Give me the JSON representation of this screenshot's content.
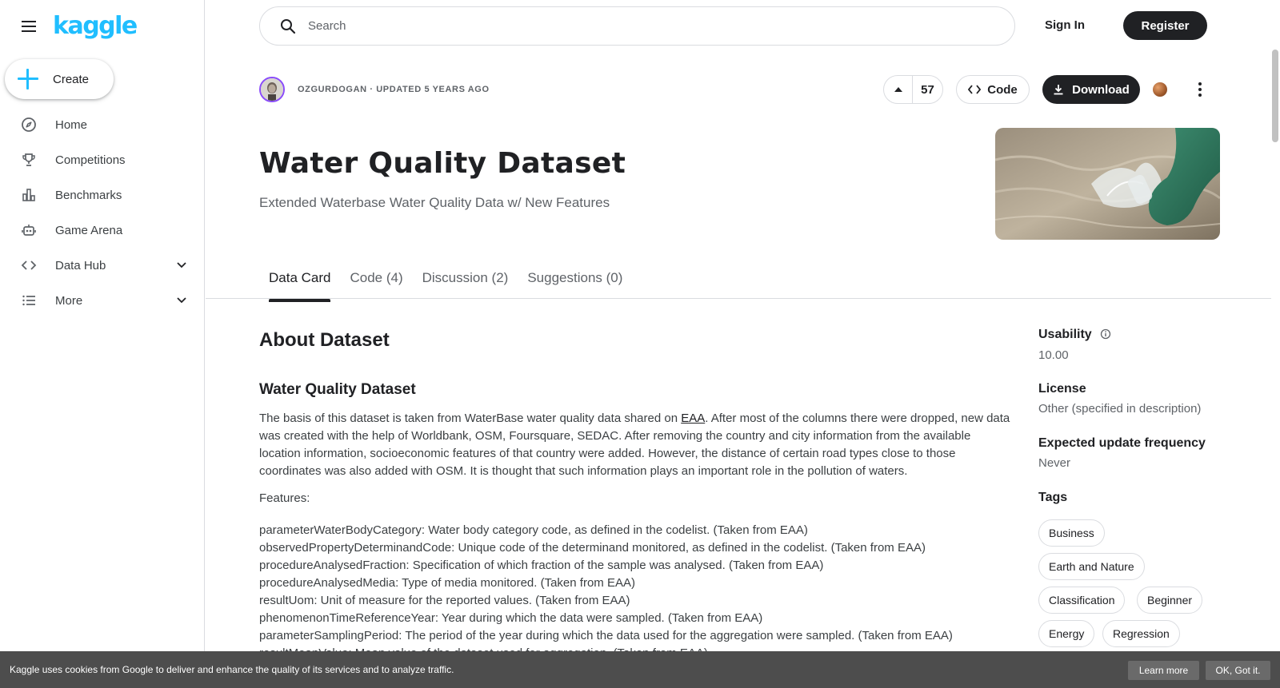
{
  "brand": {
    "logo": "kaggle",
    "accent": "#20beff",
    "dark": "#202124"
  },
  "sidebar": {
    "create_label": "Create",
    "items": [
      {
        "label": "Home",
        "icon": "compass-icon"
      },
      {
        "label": "Competitions",
        "icon": "trophy-icon"
      },
      {
        "label": "Benchmarks",
        "icon": "bar-chart-icon"
      },
      {
        "label": "Game Arena",
        "icon": "robot-icon"
      },
      {
        "label": "Data Hub",
        "icon": "code-brackets-icon",
        "expandable": true
      },
      {
        "label": "More",
        "icon": "list-icon",
        "expandable": true
      }
    ]
  },
  "header": {
    "search_placeholder": "Search",
    "sign_in": "Sign In",
    "register": "Register"
  },
  "dataset": {
    "owner_line": "OZGURDOGAN · UPDATED 5 YEARS AGO",
    "votes": "57",
    "code_label": "Code",
    "download_label": "Download",
    "title": "Water Quality Dataset",
    "subtitle": "Extended Waterbase Water Quality Data w/ New Features"
  },
  "tabs": [
    {
      "label": "Data Card",
      "active": true
    },
    {
      "label": "Code (4)"
    },
    {
      "label": "Discussion (2)"
    },
    {
      "label": "Suggestions (0)"
    }
  ],
  "content": {
    "about_heading": "About Dataset",
    "section_heading": "Water Quality Dataset",
    "para_before_link": "The basis of this dataset is taken from WaterBase water quality data shared on ",
    "para_link": "EAA",
    "para_after_link": ". After most of the columns there were dropped, new data was created with the help of Worldbank, OSM, Foursquare, SEDAC. After removing the country and city information from the available location information, socioeconomic features of that country were added. However, the distance of certain road types close to those coordinates was also added with OSM. It is thought that such information plays an important role in the pollution of waters.",
    "features_label": "Features:",
    "features": [
      "parameterWaterBodyCategory: Water body category code, as defined in the codelist. (Taken from EAA)",
      "observedPropertyDeterminandCode: Unique code of the determinand monitored, as defined in the codelist. (Taken from EAA)",
      "procedureAnalysedFraction: Specification of which fraction of the sample was analysed. (Taken from EAA)",
      "procedureAnalysedMedia: Type of media monitored. (Taken from EAA)",
      "resultUom: Unit of measure for the reported values. (Taken from EAA)",
      "phenomenonTimeReferenceYear: Year during which the data were sampled. (Taken from EAA)",
      "parameterSamplingPeriod: The period of the year during which the data used for the aggregation were sampled. (Taken from EAA)",
      "resultMeanValue: Mean value of the dataset used for aggregation. (Taken from EAA)"
    ]
  },
  "meta": {
    "usability_label": "Usability",
    "usability_value": "10.00",
    "license_label": "License",
    "license_value": "Other (specified in description)",
    "frequency_label": "Expected update frequency",
    "frequency_value": "Never",
    "tags_label": "Tags",
    "tags": [
      "Business",
      "Earth and Nature",
      "Classification",
      "Beginner",
      "Energy",
      "Regression"
    ]
  },
  "cookie": {
    "text": "Kaggle uses cookies from Google to deliver and enhance the quality of its services and to analyze traffic.",
    "learn_more": "Learn more",
    "ok": "OK, Got it."
  }
}
